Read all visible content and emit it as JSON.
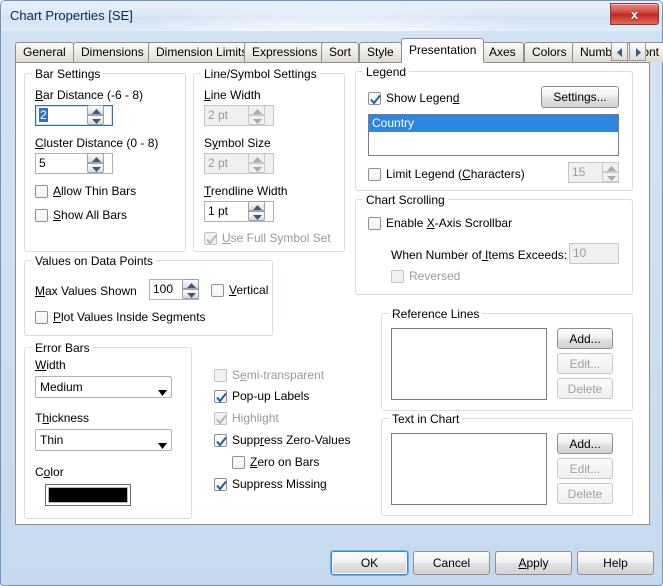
{
  "window": {
    "title": "Chart Properties [SE]",
    "close_label": "x",
    "accent_blue": "#2f86e0",
    "titlebar_from": "#e9f1fa",
    "titlebar_to": "#d2e2f3"
  },
  "tabs": {
    "items": [
      {
        "label": "General",
        "active": false
      },
      {
        "label": "Dimensions",
        "active": false
      },
      {
        "label": "Dimension Limits",
        "active": false
      },
      {
        "label": "Expressions",
        "active": false
      },
      {
        "label": "Sort",
        "active": false
      },
      {
        "label": "Style",
        "active": false
      },
      {
        "label": "Presentation",
        "active": true
      },
      {
        "label": "Axes",
        "active": false
      },
      {
        "label": "Colors",
        "active": false
      },
      {
        "label": "Number",
        "active": false
      },
      {
        "label": "Font",
        "active": false
      }
    ],
    "scroll_left_icon": "triangle-left-icon",
    "scroll_right_icon": "triangle-right-icon"
  },
  "bar_settings": {
    "title": "Bar Settings",
    "bar_distance_label": "Bar Distance (-6 - 8)",
    "bar_distance_value": "2",
    "cluster_distance_label": "Cluster Distance (0 - 8)",
    "cluster_distance_value": "5",
    "allow_thin_bars_label": "Allow Thin Bars",
    "allow_thin_bars_checked": false,
    "show_all_bars_label": "Show All Bars",
    "show_all_bars_checked": false
  },
  "line_symbol_settings": {
    "title": "Line/Symbol Settings",
    "line_width_label": "Line Width",
    "line_width_value": "2 pt",
    "symbol_size_label": "Symbol Size",
    "symbol_size_value": "2 pt",
    "trendline_width_label": "Trendline Width",
    "trendline_width_value": "1 pt",
    "use_full_symbol_set_label": "Use Full Symbol Set",
    "use_full_symbol_set_checked": true
  },
  "legend": {
    "title": "Legend",
    "show_legend_label": "Show Legend",
    "show_legend_checked": true,
    "settings_button": "Settings...",
    "items": [
      {
        "label": "Country",
        "selected": true
      }
    ],
    "limit_legend_label": "Limit Legend (Characters)",
    "limit_legend_checked": false,
    "limit_legend_value": "15"
  },
  "chart_scrolling": {
    "title": "Chart Scrolling",
    "enable_scrollbar_label": "Enable X-Axis Scrollbar",
    "enable_scrollbar_checked": false,
    "items_exceeds_label": "When Number of Items Exceeds:",
    "items_exceeds_value": "10",
    "reversed_label": "Reversed",
    "reversed_checked": false
  },
  "values_on_data_points": {
    "title": "Values on Data Points",
    "max_values_label": "Max Values Shown",
    "max_values_value": "100",
    "vertical_label": "Vertical",
    "vertical_checked": false,
    "plot_inside_label": "Plot Values Inside Segments",
    "plot_inside_checked": false
  },
  "error_bars": {
    "title": "Error Bars",
    "width_label": "Width",
    "width_value": "Medium",
    "thickness_label": "Thickness",
    "thickness_value": "Thin",
    "color_label": "Color",
    "color_value": "#000000"
  },
  "display_options": {
    "semi_transparent_label": "Semi-transparent",
    "semi_transparent_checked": false,
    "popup_labels_label": "Pop-up Labels",
    "popup_labels_checked": true,
    "highlight_label": "Highlight",
    "highlight_checked": true,
    "suppress_zero_label": "Suppress Zero-Values",
    "suppress_zero_checked": true,
    "zero_on_bars_label": "Zero on Bars",
    "zero_on_bars_checked": false,
    "suppress_missing_label": "Suppress Missing",
    "suppress_missing_checked": true
  },
  "reference_lines": {
    "title": "Reference Lines",
    "items": [],
    "add_button": "Add...",
    "edit_button": "Edit...",
    "delete_button": "Delete"
  },
  "text_in_chart": {
    "title": "Text in Chart",
    "items": [],
    "add_button": "Add...",
    "edit_button": "Edit...",
    "delete_button": "Delete"
  },
  "footer": {
    "ok": "OK",
    "cancel": "Cancel",
    "apply": "Apply",
    "help": "Help"
  }
}
